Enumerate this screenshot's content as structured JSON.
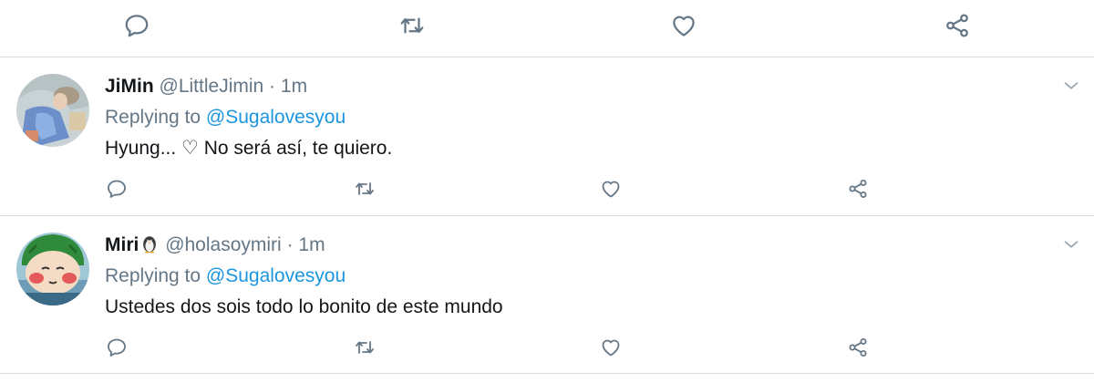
{
  "top_actions": {
    "icons": [
      "reply-icon",
      "retweet-icon",
      "like-icon",
      "share-icon"
    ]
  },
  "tweets": [
    {
      "display_name": "JiMin",
      "display_emoji": "",
      "handle": "@LittleJimin",
      "separator": "·",
      "time": "1m",
      "replying_prefix": "Replying to",
      "replying_to": "@Sugalovesyou",
      "text": "Hyung... ♡ No será así, te quiero.",
      "avatar": "avatar-jimin"
    },
    {
      "display_name": "Miri",
      "display_emoji": "penguin-emoji",
      "handle": "@holasoymiri",
      "separator": "·",
      "time": "1m",
      "replying_prefix": "Replying to",
      "replying_to": "@Sugalovesyou",
      "text": "Ustedes dos sois todo lo bonito de este mundo",
      "avatar": "avatar-miri"
    }
  ],
  "colors": {
    "icon_gray": "#657786",
    "link_blue": "#1b95e0",
    "divider": "#d6dadd",
    "text": "#14171a"
  }
}
